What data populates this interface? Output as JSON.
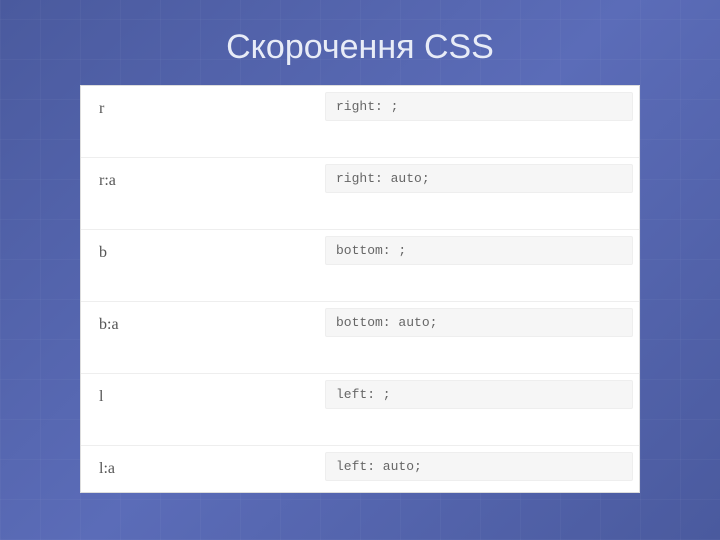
{
  "title": "Скорочення CSS",
  "rows": [
    {
      "abbr": "r",
      "expansion": "right: ;"
    },
    {
      "abbr": "r:a",
      "expansion": "right: auto;"
    },
    {
      "abbr": "b",
      "expansion": "bottom: ;"
    },
    {
      "abbr": "b:a",
      "expansion": "bottom: auto;"
    },
    {
      "abbr": "l",
      "expansion": "left: ;"
    },
    {
      "abbr": "l:a",
      "expansion": "left: auto;"
    }
  ]
}
